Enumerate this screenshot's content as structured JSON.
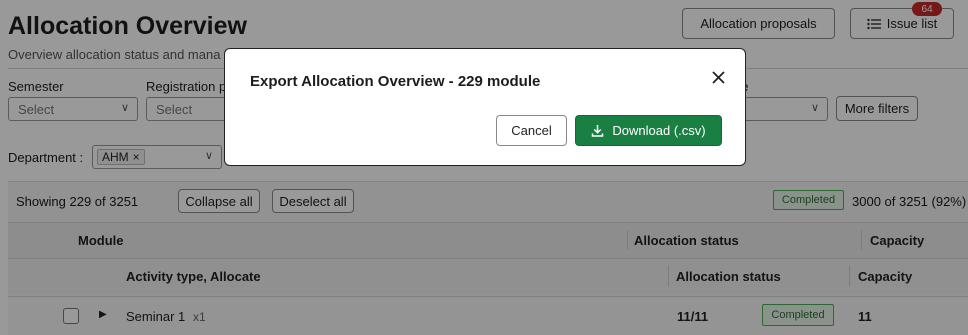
{
  "page": {
    "title": "Allocation Overview",
    "subtitle": "Overview allocation status and mana"
  },
  "toolbar": {
    "proposals_label": "Allocation proposals",
    "issues_label": "Issue list",
    "issues_count": "64"
  },
  "filters": {
    "semester_label": "Semester",
    "semester_placeholder": "Select",
    "registration_label": "Registration p",
    "registration_placeholder": "Select",
    "type_label_fragment": "pe",
    "more_filters_label": "More filters",
    "department_label": "Department :",
    "department_chip": "AHM"
  },
  "results": {
    "showing": "Showing 229 of 3251",
    "collapse_all": "Collapse all",
    "deselect_all": "Deselect all",
    "status_badge": "Completed",
    "summary": "3000 of 3251 (92%)"
  },
  "table": {
    "header_1": {
      "module": "Module",
      "allocation_status": "Allocation status",
      "capacity": "Capacity"
    },
    "header_2": {
      "activity": "Activity type, Allocate",
      "allocation_status": "Allocation status",
      "capacity": "Capacity"
    },
    "rows": [
      {
        "activity": "Seminar 1",
        "multiplier": "x1",
        "allocation": "11/11",
        "status": "Completed",
        "capacity": "11"
      }
    ]
  },
  "modal": {
    "title": "Export Allocation Overview - 229 module",
    "cancel_label": "Cancel",
    "download_label": "Download (.csv)"
  },
  "colors": {
    "primary": "#1a7f43",
    "badge_alert": "#c62828",
    "completed_border": "#4caf50"
  }
}
